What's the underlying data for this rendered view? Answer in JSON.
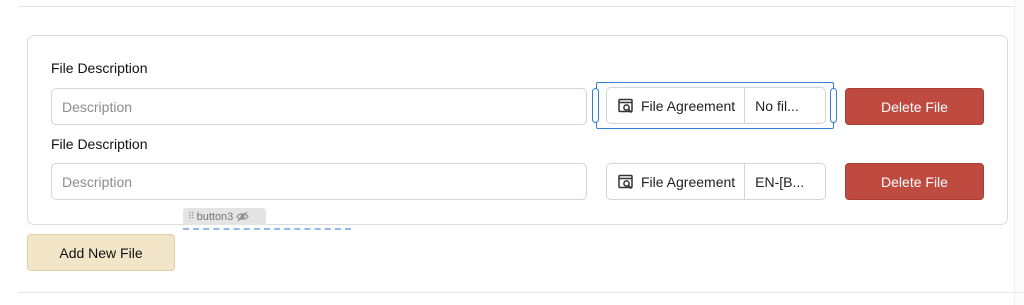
{
  "file_rows": [
    {
      "label": "File Description",
      "description_placeholder": "Description",
      "description_value": "",
      "picker_button_label": "File Agreement",
      "file_name": "No fil...",
      "delete_label": "Delete File"
    },
    {
      "label": "File Description",
      "description_placeholder": "Description",
      "description_value": "",
      "picker_button_label": "File Agreement",
      "file_name": "EN-[B...",
      "delete_label": "Delete File"
    }
  ],
  "component_tag": {
    "label": "button3",
    "drag_icon": "drag-handle-icon",
    "visibility_icon": "eye-off-icon"
  },
  "picker_icon": "file-search-icon",
  "add_button_label": "Add New File",
  "colors": {
    "delete": "#bf4b40",
    "add": "#f3e6c8",
    "selection": "#2f7fd6"
  }
}
